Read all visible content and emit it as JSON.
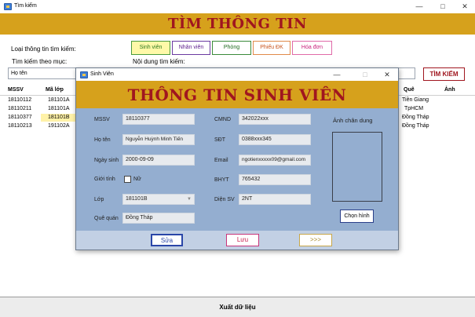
{
  "main": {
    "window_title": "Tìm kiếm",
    "header": "TÌM THÔNG TIN",
    "search_type_label": "Loại thông tin tìm kiếm:",
    "type_buttons": [
      {
        "label": "Sinh viên",
        "color": "#2b7a1f"
      },
      {
        "label": "Nhân viên",
        "color": "#5a1a8a"
      },
      {
        "label": "Phòng",
        "color": "#1f6a1f"
      },
      {
        "label": "Phiếu ĐK",
        "color": "#c8551e"
      },
      {
        "label": "Hóa đơn",
        "color": "#c81e7a"
      }
    ],
    "search_by_label": "Tìm kiếm theo mục:",
    "search_by_value": "Họ tên",
    "content_label": "Nội dung tìm kiếm:",
    "search_button": "TÌM KIẾM",
    "grid": {
      "columns": [
        "MSSV",
        "Mã lớp",
        "Quê",
        "Ảnh"
      ],
      "rows": [
        {
          "mssv": "18110112",
          "lop": "181101A",
          "que": "Tiền Giang"
        },
        {
          "mssv": "18110211",
          "lop": "181101A",
          "que": "TpHCM"
        },
        {
          "mssv": "18110377",
          "lop": "181101B",
          "que": "Đồng Tháp"
        },
        {
          "mssv": "18110213",
          "lop": "191102A",
          "que": "Đồng Tháp"
        }
      ]
    },
    "export_button": "Xuất dữ liệu"
  },
  "dialog": {
    "window_title": "Sinh Viên",
    "header": "THÔNG TIN SINH VIÊN",
    "mssv_label": "MSSV",
    "mssv": "18110377",
    "hoten_label": "Họ tên",
    "hoten": "Nguyễn Huỳnh Minh Tiến",
    "ngaysinh_label": "Ngày sinh",
    "ngaysinh": "2000-09-09",
    "gioitinh_label": "Giới tính",
    "nu_label": "Nữ",
    "lop_label": "Lớp",
    "lop": "181101B",
    "quequan_label": "Quê quán",
    "quequan": "Đồng Tháp",
    "cmnd_label": "CMND",
    "cmnd": "342022xxx",
    "sdt_label": "SĐT",
    "sdt": "0388xxx345",
    "email_label": "Email",
    "email": "ngotienxxxxx09@gmail.com",
    "bhyt_label": "BHYT",
    "bhyt": "765432",
    "diensv_label": "Diện SV",
    "diensv": "2NT",
    "photo_label": "Ảnh chân dung",
    "choose_image": "Chọn hình",
    "btn_sua": "Sửa",
    "btn_luu": "Lưu",
    "btn_next": ">>>"
  }
}
